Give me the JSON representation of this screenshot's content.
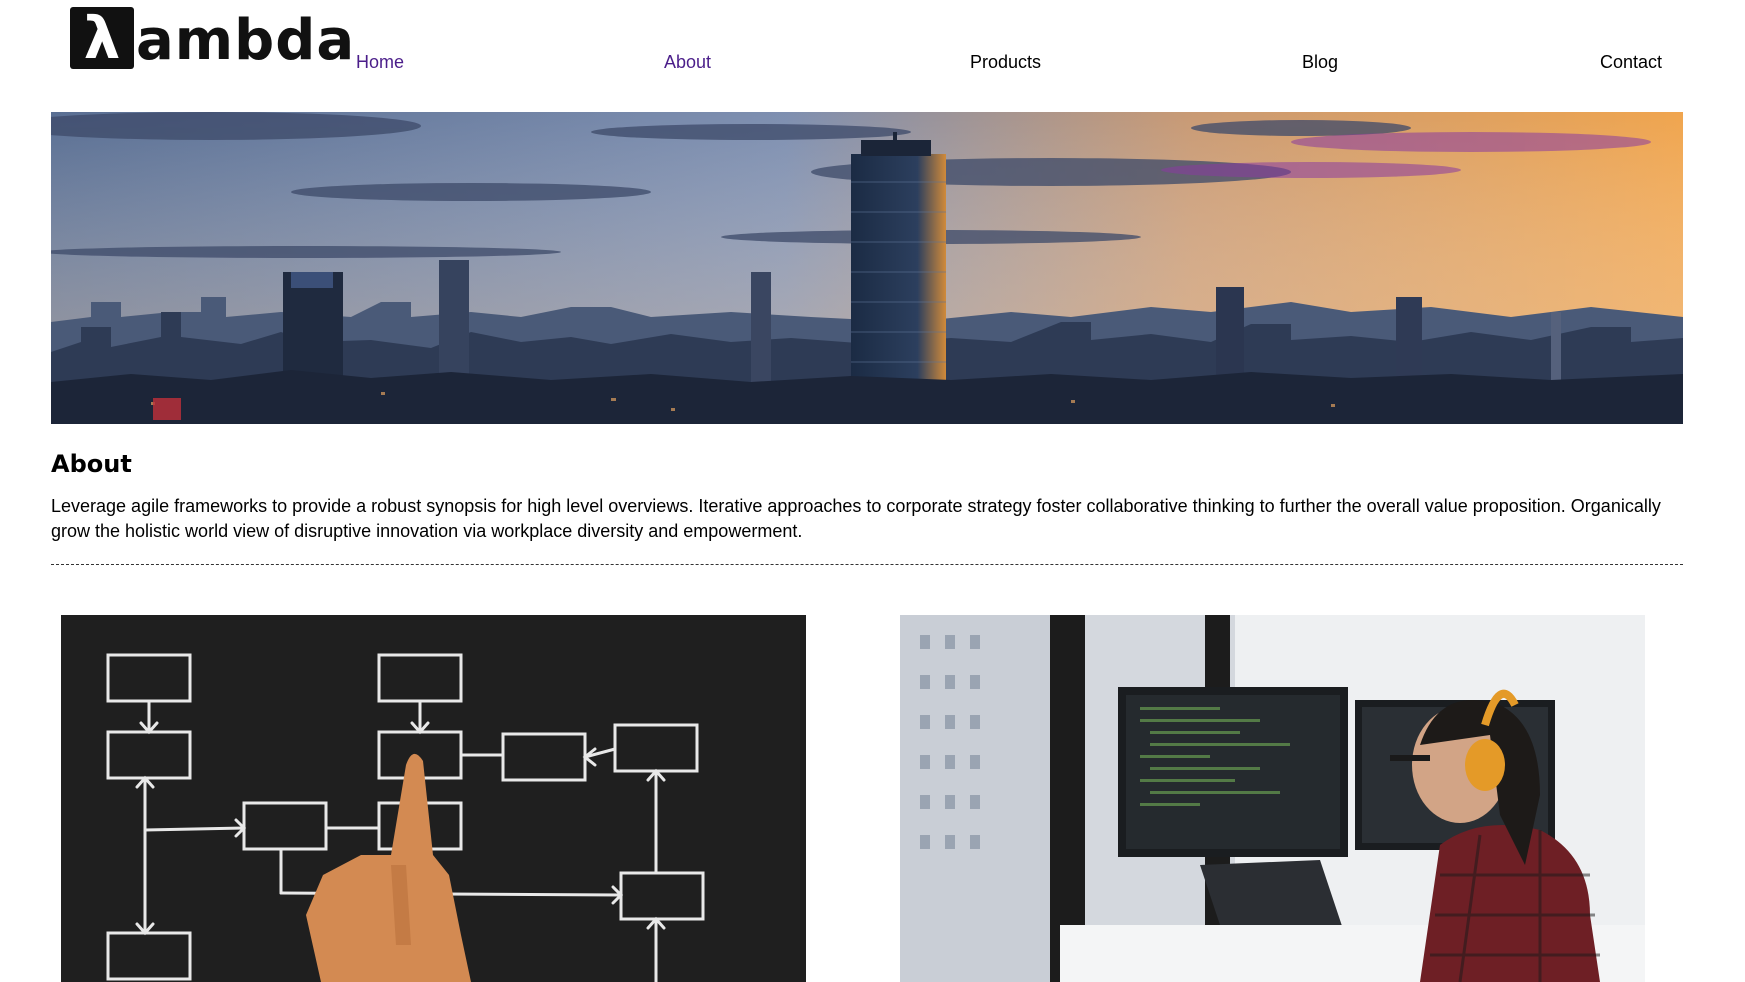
{
  "brand": {
    "logo_mark": "λ",
    "logo_text": "ambda"
  },
  "nav": {
    "items": [
      {
        "label": "Home",
        "state": "visited"
      },
      {
        "label": "About",
        "state": "visited"
      },
      {
        "label": "Products",
        "state": "normal"
      },
      {
        "label": "Blog",
        "state": "normal"
      },
      {
        "label": "Contact",
        "state": "normal"
      }
    ]
  },
  "hero": {
    "image": "city-skyline-sunset"
  },
  "about": {
    "title": "About",
    "body": "Leverage agile frameworks to provide a robust synopsis for high level overviews. Iterative approaches to corporate strategy foster collaborative thinking to further the overall value proposition. Organically grow the holistic world view of disruptive innovation via workplace diversity and empowerment."
  },
  "gallery": {
    "left_image": "flowchart-chalkboard",
    "right_image": "developer-at-monitors"
  },
  "colors": {
    "visited_link": "#4b1e8a",
    "link": "#000000"
  }
}
